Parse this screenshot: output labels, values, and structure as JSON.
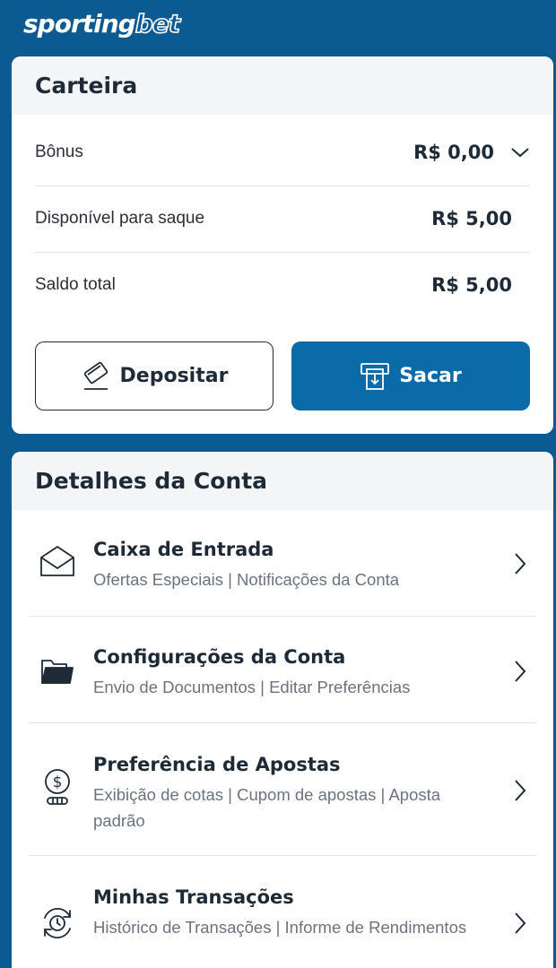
{
  "brand": {
    "part1": "sporting",
    "part2": "bet"
  },
  "wallet": {
    "title": "Carteira",
    "rows": [
      {
        "label": "Bônus",
        "value": "R$ 0,00"
      },
      {
        "label": "Disponível para saque",
        "value": "R$ 5,00"
      },
      {
        "label": "Saldo total",
        "value": "R$ 5,00"
      }
    ],
    "deposit_label": "Depositar",
    "withdraw_label": "Sacar"
  },
  "account": {
    "title": "Detalhes da Conta",
    "items": [
      {
        "title": "Caixa de Entrada",
        "subtitle": "Ofertas Especiais | Notificações da Conta",
        "icon": "envelope-icon"
      },
      {
        "title": "Configurações da Conta",
        "subtitle": "Envio de Documentos | Editar Preferências",
        "icon": "folder-icon"
      },
      {
        "title": "Preferência de Apostas",
        "subtitle": "Exibição de cotas | Cupom de apostas | Aposta padrão",
        "icon": "dollar-coin-icon"
      },
      {
        "title": "Minhas Transações",
        "subtitle": "Histórico de Transações | Informe de Rendimentos",
        "icon": "transaction-clock-icon"
      }
    ]
  },
  "colors": {
    "primary": "#0b5a92",
    "button": "#0b6aa8"
  }
}
